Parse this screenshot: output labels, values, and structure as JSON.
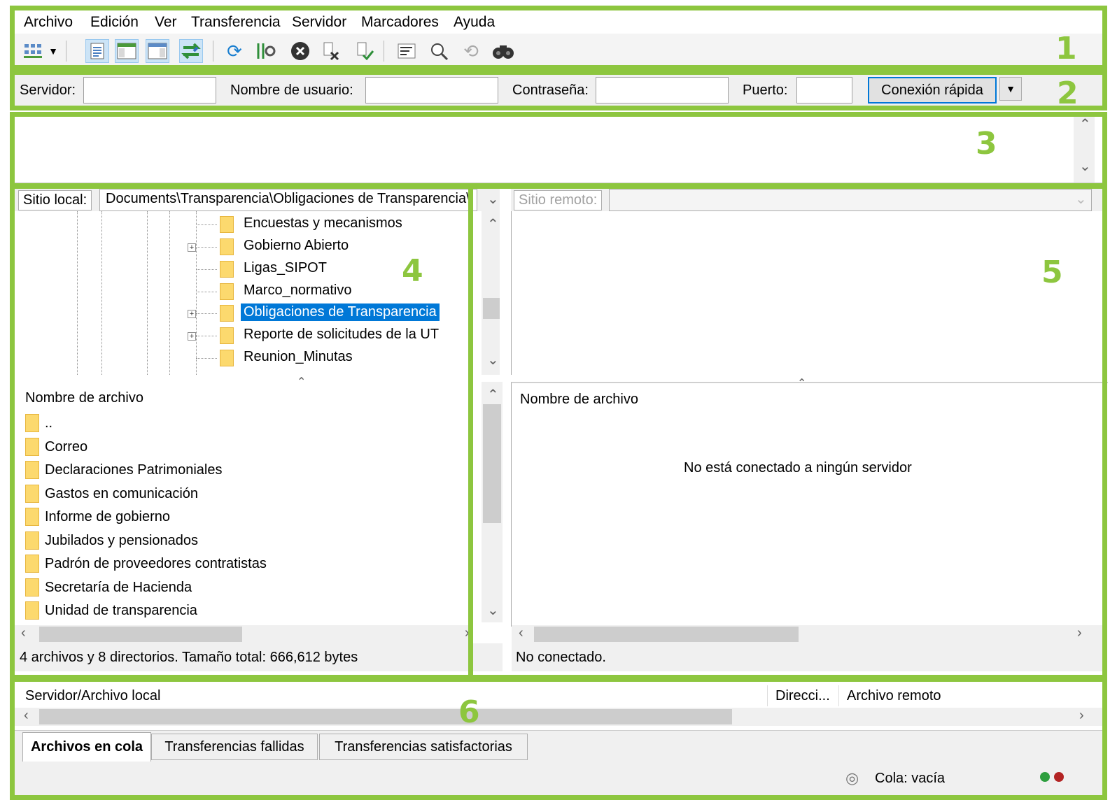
{
  "menu": {
    "items": [
      "Archivo",
      "Edición",
      "Ver",
      "Transferencia",
      "Servidor",
      "Marcadores",
      "Ayuda"
    ]
  },
  "toolbar": {
    "icons": [
      "site-manager-icon",
      "dropdown-arrow-icon",
      "message-log-icon",
      "local-tree-icon",
      "remote-tree-icon",
      "transfer-queue-icon",
      "refresh-icon",
      "process-queue-icon",
      "cancel-icon",
      "disconnect-icon",
      "reconnect-icon",
      "directory-listing-filter-icon",
      "compare-icon",
      "sync-browse-icon",
      "search-icon"
    ]
  },
  "quickconnect": {
    "server_label": "Servidor:",
    "user_label": "Nombre de usuario:",
    "password_label": "Contraseña:",
    "port_label": "Puerto:",
    "server_value": "",
    "user_value": "",
    "password_value": "",
    "port_value": "",
    "button": "Conexión rápida"
  },
  "local": {
    "site_label": "Sitio local:",
    "path": "Documents\\Transparencia\\Obligaciones de Transparencia\\",
    "tree": [
      {
        "label": "Encuestas y mecanismos",
        "expandable": false,
        "selected": false
      },
      {
        "label": "Gobierno Abierto",
        "expandable": true,
        "selected": false
      },
      {
        "label": "Ligas_SIPOT",
        "expandable": false,
        "selected": false
      },
      {
        "label": "Marco_normativo",
        "expandable": false,
        "selected": false
      },
      {
        "label": "Obligaciones de Transparencia",
        "expandable": true,
        "selected": true
      },
      {
        "label": "Reporte de solicitudes de la UT",
        "expandable": true,
        "selected": false
      },
      {
        "label": "Reunion_Minutas",
        "expandable": false,
        "selected": false
      }
    ],
    "file_header": "Nombre de archivo",
    "files": [
      "..",
      "Correo",
      "Declaraciones Patrimoniales",
      "Gastos en comunicación",
      "Informe de gobierno",
      "Jubilados y pensionados",
      "Padrón de proveedores contratistas",
      "Secretaría de Hacienda",
      "Unidad de transparencia"
    ],
    "status": "4 archivos y 8 directorios. Tamaño total: 666,612 bytes"
  },
  "remote": {
    "site_label": "Sitio remoto:",
    "path": "",
    "file_header": "Nombre de archivo",
    "empty_message": "No está conectado a ningún servidor",
    "status": "No conectado."
  },
  "queue": {
    "columns": [
      "Servidor/Archivo local",
      "Direcci...",
      "Archivo remoto"
    ],
    "tabs": [
      "Archivos en cola",
      "Transferencias fallidas",
      "Transferencias satisfactorias"
    ],
    "status": "Cola: vacía"
  },
  "annotations": {
    "labels": [
      "1",
      "2",
      "3",
      "4",
      "5",
      "6"
    ],
    "color": "#8dc63f"
  },
  "colors": {
    "selection": "#0078d7",
    "folder": "#fcd96e",
    "chrome": "#f0f0f0"
  }
}
